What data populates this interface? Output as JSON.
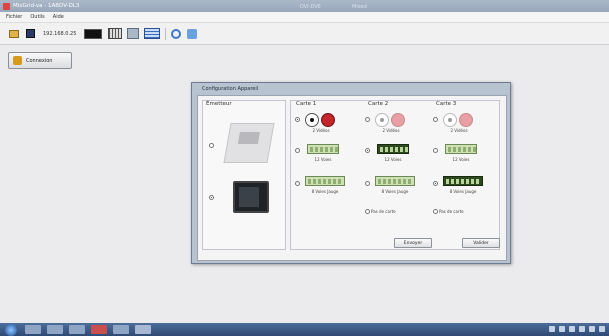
{
  "app": {
    "title": "MixGrid-va - 1ABDV-DL3",
    "window_title_blurred": [
      "DVI-DVE",
      "Mixed"
    ]
  },
  "menu": [
    "Fichier",
    "Outils",
    "Aide"
  ],
  "toolbar": {
    "address": "192.168.0.25",
    "icons": [
      "open-folder-icon",
      "save-icon",
      "black-monitor-icon",
      "grid-icon",
      "network-icon",
      "table-icon",
      "lens-icon",
      "chat-icon"
    ]
  },
  "connect_button": {
    "label": "Connexion"
  },
  "dialog": {
    "title": "Configuration Appareil",
    "emitter": {
      "title": "Émetteur"
    },
    "cards": [
      {
        "title": "Carte 1",
        "options": [
          {
            "label": "2 Vidéos",
            "selected": true
          },
          {
            "label": "12 Voies",
            "selected": false
          },
          {
            "label": "8 Voies Jauge",
            "selected": false
          }
        ]
      },
      {
        "title": "Carte 2",
        "options": [
          {
            "label": "2 Vidéos",
            "selected": false
          },
          {
            "label": "12 Voies",
            "selected": true
          },
          {
            "label": "8 Voies Jauge",
            "selected": false
          },
          {
            "label": "Pas de carte",
            "selected": false
          }
        ]
      },
      {
        "title": "Carte 3",
        "options": [
          {
            "label": "2 Vidéos",
            "selected": false
          },
          {
            "label": "12 Voies",
            "selected": false
          },
          {
            "label": "8 Voies Jauge",
            "selected": true
          },
          {
            "label": "Pas de carte",
            "selected": false
          }
        ]
      }
    ],
    "buttons": {
      "primary": "Envoyer",
      "secondary": "Valider"
    }
  },
  "colors": {
    "dialog_frame": "#b8c3d1",
    "taskbar": "#2f4a73",
    "video_red": "#c0262a",
    "terminal_green": "#cfe0b5"
  }
}
